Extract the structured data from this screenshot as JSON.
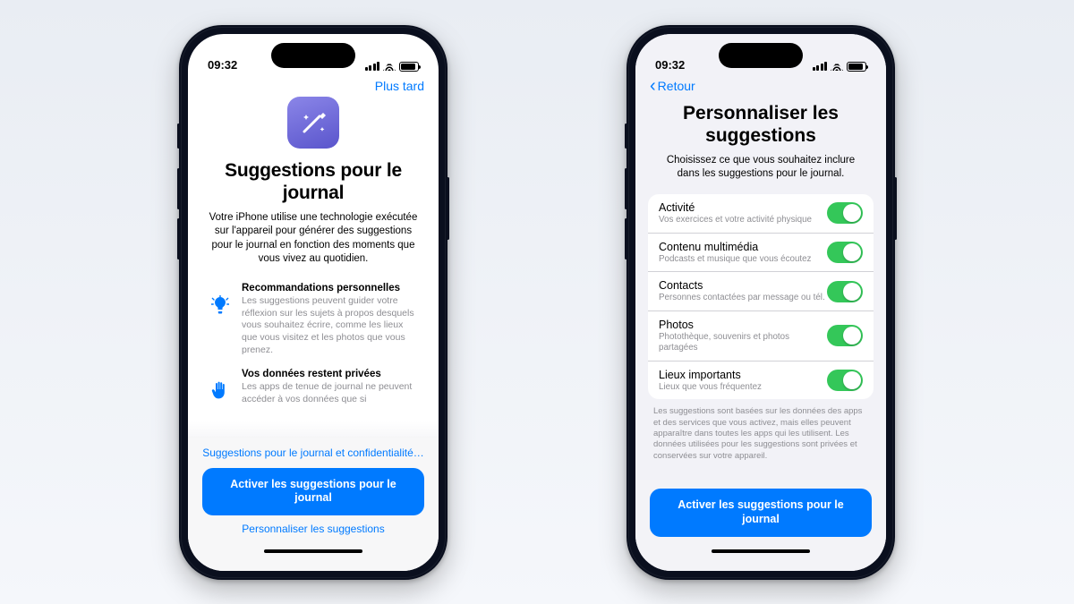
{
  "colors": {
    "blue": "#007aff",
    "green": "#34c759",
    "purple": "#6e6bd8"
  },
  "status": {
    "time": "09:32"
  },
  "left": {
    "skip": "Plus tard",
    "icon": "magic-wand-sparkle-icon",
    "title": "Suggestions pour le journal",
    "lead": "Votre iPhone utilise une technologie exécutée sur l'appareil pour générer des suggestions pour le journal en fonction des moments que vous vivez au quotidien.",
    "features": [
      {
        "icon": "lightbulb-icon",
        "title": "Recommandations personnelles",
        "desc": "Les suggestions peuvent guider votre réflexion sur les sujets à propos desquels vous souhaitez écrire, comme les lieux que vous visitez et les photos que vous prenez."
      },
      {
        "icon": "hand-raised-icon",
        "title": "Vos données restent privées",
        "desc": "Les apps de tenue de journal ne peuvent accéder à vos données que si"
      }
    ],
    "privacy_link": "Suggestions pour le journal et confidentialité…",
    "cta": "Activer les suggestions pour le journal",
    "customize_link": "Personnaliser les suggestions"
  },
  "right": {
    "back": "Retour",
    "title": "Personnaliser les suggestions",
    "sub": "Choisissez ce que vous souhaitez inclure dans les suggestions pour le journal.",
    "items": [
      {
        "title": "Activité",
        "desc": "Vos exercices et votre activité physique",
        "on": true
      },
      {
        "title": "Contenu multimédia",
        "desc": "Podcasts et musique que vous écoutez",
        "on": true
      },
      {
        "title": "Contacts",
        "desc": "Personnes contactées par message ou tél.",
        "on": true
      },
      {
        "title": "Photos",
        "desc": "Photothèque, souvenirs et photos partagées",
        "on": true
      },
      {
        "title": "Lieux importants",
        "desc": "Lieux que vous fréquentez",
        "on": true
      }
    ],
    "fineprint": "Les suggestions sont basées sur les données des apps et des services que vous activez, mais elles peuvent apparaître dans toutes les apps qui les utilisent. Les données utilisées pour les suggestions sont privées et conservées sur votre appareil.",
    "cta": "Activer les suggestions pour le journal"
  }
}
